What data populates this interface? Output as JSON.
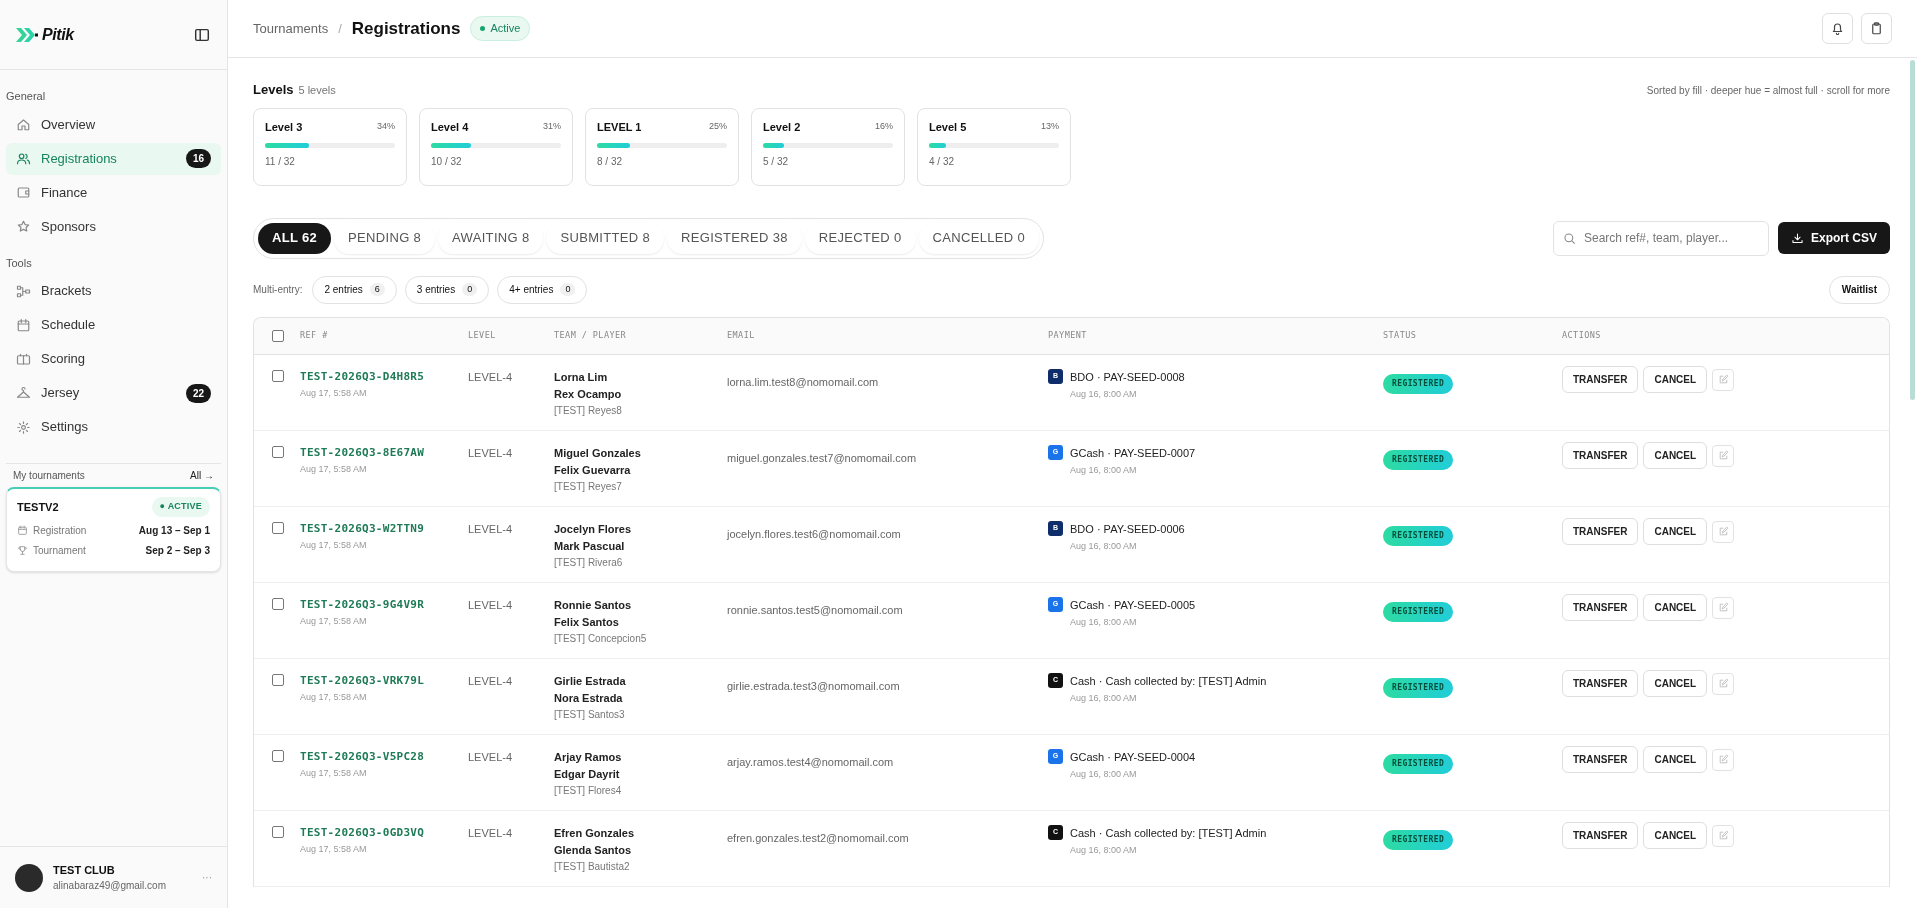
{
  "sidebar": {
    "brand": "Pitik",
    "sections": [
      {
        "title": "General",
        "items": [
          {
            "label": "Overview",
            "selected": false
          },
          {
            "label": "Registrations",
            "selected": true,
            "badge": "16"
          },
          {
            "label": "Finance",
            "selected": false
          },
          {
            "label": "Sponsors",
            "selected": false
          }
        ]
      },
      {
        "title": "Tools",
        "items": [
          {
            "label": "Brackets",
            "selected": false
          },
          {
            "label": "Schedule",
            "selected": false
          },
          {
            "label": "Scoring",
            "selected": false
          },
          {
            "label": "Jersey",
            "selected": false,
            "badge": "22"
          },
          {
            "label": "Settings",
            "selected": false
          }
        ]
      }
    ],
    "my_tournaments": {
      "title": "My tournaments",
      "link": "All →",
      "card": {
        "name": "TESTV2",
        "status": "● ACTIVE",
        "rows": [
          {
            "label": "Registration",
            "value": "Aug 13 – Sep 1"
          },
          {
            "label": "Tournament",
            "value": "Sep 2 – Sep 3"
          }
        ]
      }
    },
    "user": {
      "name": "TEST CLUB",
      "email": "alinabaraz49@gmail.com",
      "menu": "···"
    }
  },
  "header": {
    "breadcrumb": "Tournaments",
    "separator": "/",
    "title": "Registrations",
    "status": "Active"
  },
  "levels": {
    "title": "Levels",
    "count": "5 levels",
    "note": "Sorted by fill · deeper hue = almost full · scroll for more",
    "cards": [
      {
        "name": "Level 3",
        "percent": "34%",
        "level": 0.34,
        "count": "11 / 32"
      },
      {
        "name": "Level 4",
        "percent": "31%",
        "level": 0.31,
        "count": "10 / 32"
      },
      {
        "name": "LEVEL 1",
        "percent": "25%",
        "level": 0.25,
        "count": "8 / 32"
      },
      {
        "name": "Level 2",
        "percent": "16%",
        "level": 0.16,
        "count": "5 / 32"
      },
      {
        "name": "Level 5",
        "percent": "13%",
        "level": 0.13,
        "count": "4 / 32"
      }
    ]
  },
  "tabs": [
    {
      "label": "ALL 62",
      "selected": true
    },
    {
      "label": "PENDING 8",
      "selected": false
    },
    {
      "label": "AWAITING 8",
      "selected": false
    },
    {
      "label": "SUBMITTED 8",
      "selected": false
    },
    {
      "label": "REGISTERED 38",
      "selected": false
    },
    {
      "label": "REJECTED 0",
      "selected": false
    },
    {
      "label": "CANCELLED 0",
      "selected": false
    }
  ],
  "search": {
    "placeholder": "Search ref#, team, player..."
  },
  "export_button": "Export CSV",
  "multi_entry": {
    "label": "Multi-entry:",
    "chips": [
      {
        "label": "2 entries",
        "count": "6"
      },
      {
        "label": "3 entries",
        "count": "0"
      },
      {
        "label": "4+ entries",
        "count": "0"
      }
    ]
  },
  "waitlist_button": "Waitlist",
  "table": {
    "select_all_checked": false,
    "columns": [
      "REF #",
      "LEVEL",
      "TEAM / PLAYER",
      "EMAIL",
      "PAYMENT",
      "STATUS",
      "ACTIONS"
    ],
    "rows": [
      {
        "checked": false,
        "ref": "TEST-2026Q3-D4H8R5",
        "date": "Aug 17, 5:58 AM",
        "level": "LEVEL-4",
        "players": [
          "Lorna Lim",
          "Rex Ocampo"
        ],
        "team": "[TEST] Reyes8",
        "email": "lorna.lim.test8@nomomail.com",
        "payment": {
          "kind": "bdo",
          "mark": "B",
          "text": "BDO · PAY-SEED-0008",
          "date": "Aug 16, 8:00 AM"
        },
        "status": {
          "kind": "registered",
          "label": "REGISTERED"
        },
        "actions": [
          "TRANSFER",
          "CANCEL"
        ]
      },
      {
        "checked": false,
        "ref": "TEST-2026Q3-8E67AW",
        "date": "Aug 17, 5:58 AM",
        "level": "LEVEL-4",
        "players": [
          "Miguel Gonzales",
          "Felix Guevarra"
        ],
        "team": "[TEST] Reyes7",
        "email": "miguel.gonzales.test7@nomomail.com",
        "payment": {
          "kind": "gcash",
          "mark": "G",
          "text": "GCash · PAY-SEED-0007",
          "date": "Aug 16, 8:00 AM"
        },
        "status": {
          "kind": "registered",
          "label": "REGISTERED"
        },
        "actions": [
          "TRANSFER",
          "CANCEL"
        ]
      },
      {
        "checked": false,
        "ref": "TEST-2026Q3-W2TTN9",
        "date": "Aug 17, 5:58 AM",
        "level": "LEVEL-4",
        "players": [
          "Jocelyn Flores",
          "Mark Pascual"
        ],
        "team": "[TEST] Rivera6",
        "email": "jocelyn.flores.test6@nomomail.com",
        "payment": {
          "kind": "bdo",
          "mark": "B",
          "text": "BDO · PAY-SEED-0006",
          "date": "Aug 16, 8:00 AM"
        },
        "status": {
          "kind": "registered",
          "label": "REGISTERED"
        },
        "actions": [
          "TRANSFER",
          "CANCEL"
        ]
      },
      {
        "checked": false,
        "ref": "TEST-2026Q3-9G4V9R",
        "date": "Aug 17, 5:58 AM",
        "level": "LEVEL-4",
        "players": [
          "Ronnie Santos",
          "Felix Santos"
        ],
        "team": "[TEST] Concepcion5",
        "email": "ronnie.santos.test5@nomomail.com",
        "payment": {
          "kind": "gcash",
          "mark": "G",
          "text": "GCash · PAY-SEED-0005",
          "date": "Aug 16, 8:00 AM"
        },
        "status": {
          "kind": "registered",
          "label": "REGISTERED"
        },
        "actions": [
          "TRANSFER",
          "CANCEL"
        ]
      },
      {
        "checked": false,
        "ref": "TEST-2026Q3-VRK79L",
        "date": "Aug 17, 5:58 AM",
        "level": "LEVEL-4",
        "players": [
          "Girlie Estrada",
          "Nora Estrada"
        ],
        "team": "[TEST] Santos3",
        "email": "girlie.estrada.test3@nomomail.com",
        "payment": {
          "kind": "cash",
          "mark": "C",
          "text": "Cash · Cash collected by: [TEST] Admin",
          "date": "Aug 16, 8:00 AM"
        },
        "status": {
          "kind": "registered",
          "label": "REGISTERED"
        },
        "actions": [
          "TRANSFER",
          "CANCEL"
        ]
      },
      {
        "checked": false,
        "ref": "TEST-2026Q3-V5PC28",
        "date": "Aug 17, 5:58 AM",
        "level": "LEVEL-4",
        "players": [
          "Arjay Ramos",
          "Edgar Dayrit"
        ],
        "team": "[TEST] Flores4",
        "email": "arjay.ramos.test4@nomomail.com",
        "payment": {
          "kind": "gcash",
          "mark": "G",
          "text": "GCash · PAY-SEED-0004",
          "date": "Aug 16, 8:00 AM"
        },
        "status": {
          "kind": "registered",
          "label": "REGISTERED"
        },
        "actions": [
          "TRANSFER",
          "CANCEL"
        ]
      },
      {
        "checked": false,
        "ref": "TEST-2026Q3-0GD3VQ",
        "date": "Aug 17, 5:58 AM",
        "level": "LEVEL-4",
        "players": [
          "Efren Gonzales",
          "Glenda Santos"
        ],
        "team": "[TEST] Bautista2",
        "email": "efren.gonzales.test2@nomomail.com",
        "payment": {
          "kind": "cash",
          "mark": "C",
          "text": "Cash · Cash collected by: [TEST] Admin",
          "date": "Aug 16, 8:00 AM"
        },
        "status": {
          "kind": "registered",
          "label": "REGISTERED"
        },
        "actions": [
          "TRANSFER",
          "CANCEL"
        ]
      }
    ]
  }
}
